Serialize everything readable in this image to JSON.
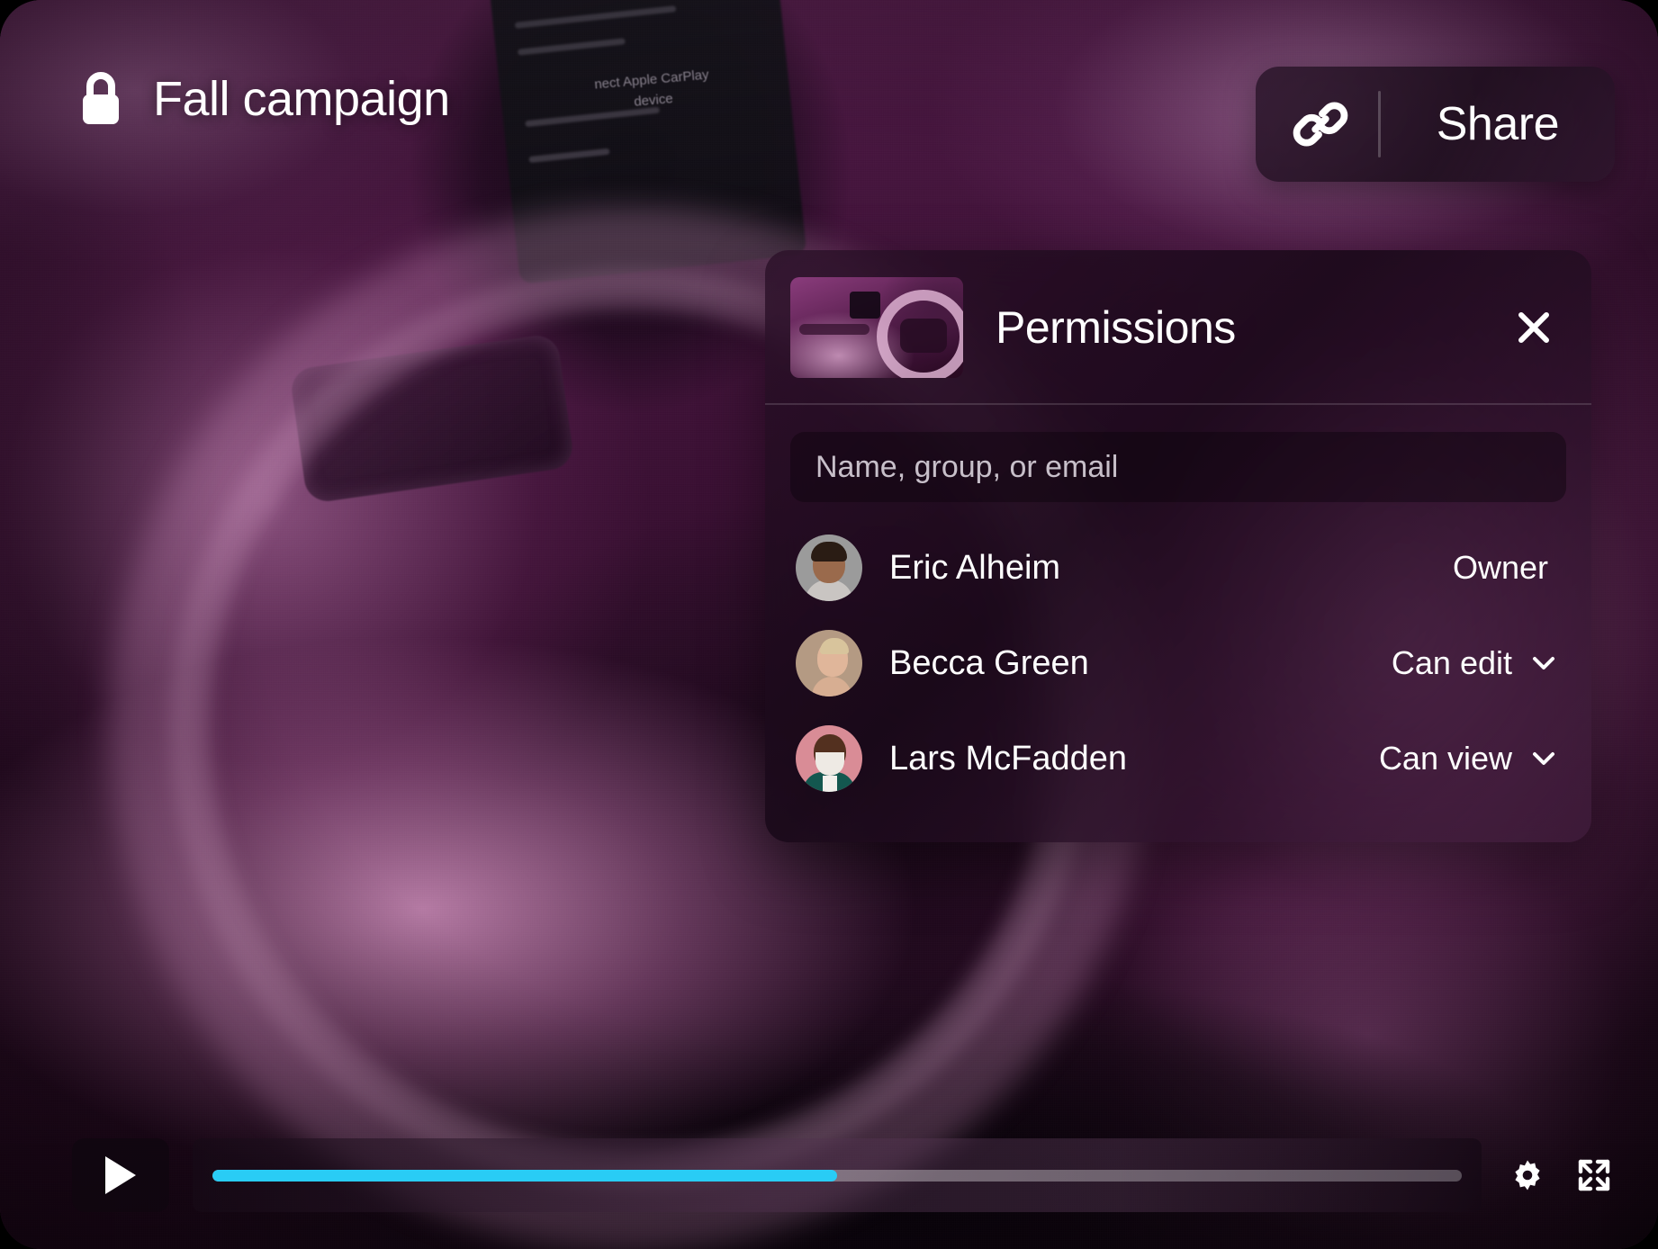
{
  "media": {
    "title": "Fall campaign",
    "lock_icon": "lock-icon",
    "thumbnail_alt": "car-interior-steering-wheel"
  },
  "share": {
    "link_icon": "link-icon",
    "label": "Share"
  },
  "permissions": {
    "title": "Permissions",
    "close_icon": "close-icon",
    "search": {
      "placeholder": "Name, group, or email",
      "value": ""
    },
    "people": [
      {
        "name": "Eric Alheim",
        "role": "Owner",
        "has_dropdown": false,
        "avatar": "avatar-eric"
      },
      {
        "name": "Becca Green",
        "role": "Can edit",
        "has_dropdown": true,
        "avatar": "avatar-becca"
      },
      {
        "name": "Lars McFadden",
        "role": "Can view",
        "has_dropdown": true,
        "avatar": "avatar-lars"
      }
    ],
    "role_options": [
      "Owner",
      "Can edit",
      "Can view"
    ]
  },
  "player_controls": {
    "play_icon": "play-icon",
    "settings_icon": "gear-icon",
    "fullscreen_icon": "fullscreen-icon",
    "progress_percent": 50
  },
  "colors": {
    "progress_accent": "#29ccf5",
    "panel_tint": "#2a0f28",
    "text_primary": "#ffffff"
  },
  "background": {
    "carplay_line_1": "nect Apple CarPlay",
    "carplay_line_2": "device"
  }
}
